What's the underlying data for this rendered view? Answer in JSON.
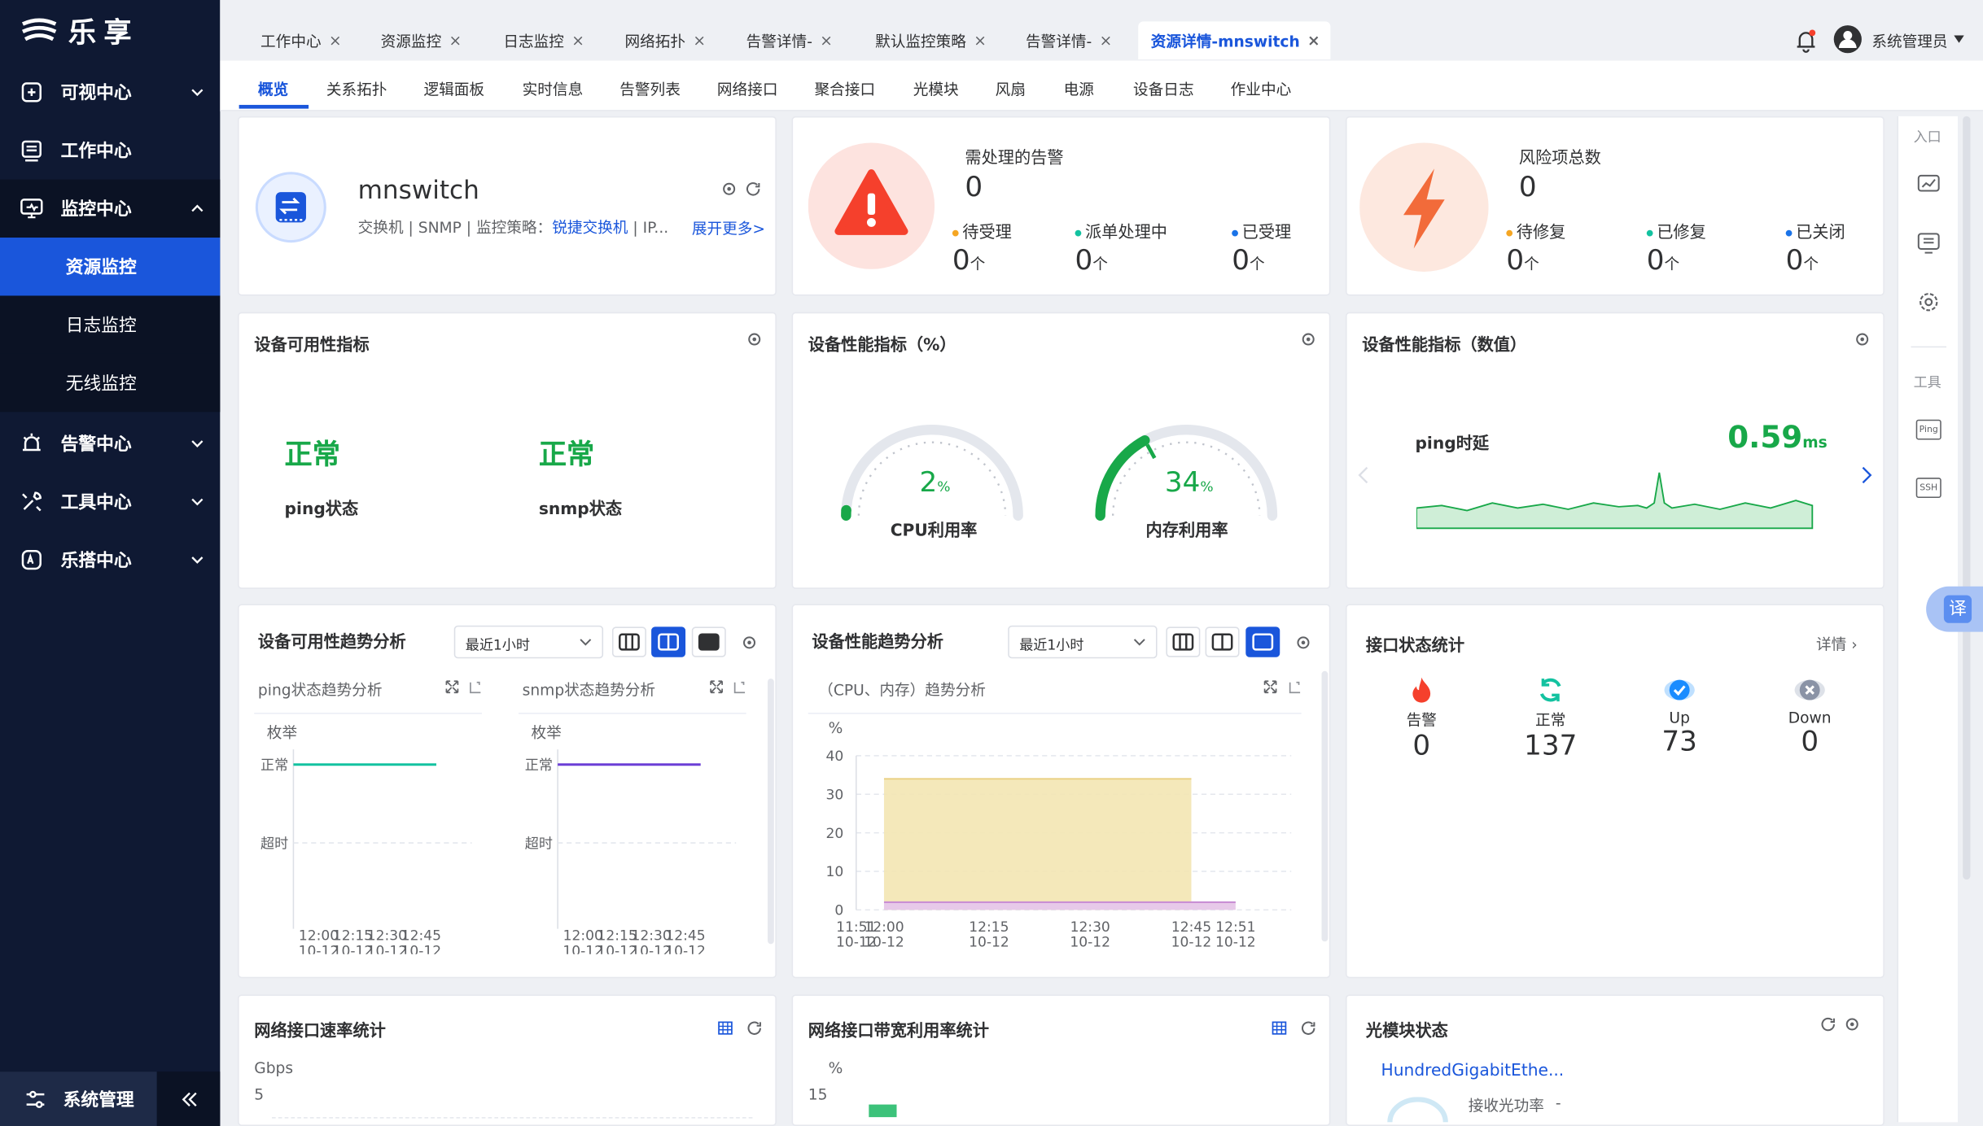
{
  "app": {
    "logo": "乐享"
  },
  "sidebar": {
    "items": [
      {
        "label": "可视中心",
        "icon": "visual-icon"
      },
      {
        "label": "工作中心",
        "icon": "work-icon"
      },
      {
        "label": "监控中心",
        "icon": "monitor-icon"
      },
      {
        "label": "告警中心",
        "icon": "alarm-icon"
      },
      {
        "label": "工具中心",
        "icon": "tools-icon"
      },
      {
        "label": "乐搭中心",
        "icon": "builder-icon"
      }
    ],
    "sub": [
      "资源监控",
      "日志监控",
      "无线监控"
    ],
    "footer": "系统管理"
  },
  "tabs": [
    "工作中心",
    "资源监控",
    "日志监控",
    "网络拓扑",
    "告警详情-",
    "默认监控策略",
    "告警详情-",
    "资源详情-mnswitch"
  ],
  "user": {
    "name": "系统管理员"
  },
  "subtabs": [
    "概览",
    "关系拓扑",
    "逻辑面板",
    "实时信息",
    "告警列表",
    "网络接口",
    "聚合接口",
    "光模块",
    "风扇",
    "电源",
    "设备日志",
    "作业中心"
  ],
  "device": {
    "name": "mnswitch",
    "desc_prefix": "交换机 | SNMP | 监控策略：",
    "policy": "锐捷交换机",
    "desc_suffix": " | IP...",
    "more": "展开更多>"
  },
  "alarms": {
    "title": "需处理的告警",
    "total": "0",
    "items": [
      {
        "label": "待受理",
        "value": "0",
        "unit": "个",
        "color": "#f5a623"
      },
      {
        "label": "派单处理中",
        "value": "0",
        "unit": "个",
        "color": "#13c2a0"
      },
      {
        "label": "已受理",
        "value": "0",
        "unit": "个",
        "color": "#1a73e8"
      }
    ]
  },
  "risks": {
    "title": "风险项总数",
    "total": "0",
    "items": [
      {
        "label": "待修复",
        "value": "0",
        "unit": "个",
        "color": "#f5a623"
      },
      {
        "label": "已修复",
        "value": "0",
        "unit": "个",
        "color": "#13c2a0"
      },
      {
        "label": "已关闭",
        "value": "0",
        "unit": "个",
        "color": "#1a73e8"
      }
    ]
  },
  "availability": {
    "title": "设备可用性指标",
    "items": [
      {
        "status": "正常",
        "label": "ping状态"
      },
      {
        "status": "正常",
        "label": "snmp状态"
      }
    ]
  },
  "perf_pct": {
    "title": "设备性能指标（%）",
    "gauges": [
      {
        "value": "2",
        "unit": "%",
        "label": "CPU利用率",
        "level": 0.02
      },
      {
        "value": "34",
        "unit": "%",
        "label": "内存利用率",
        "level": 0.34
      }
    ]
  },
  "perf_val": {
    "title": "设备性能指标（数值）",
    "label": "ping时延",
    "value": "0.59",
    "unit": "ms"
  },
  "avail_trend": {
    "title": "设备可用性趋势分析",
    "range": "最近1小时",
    "panels": [
      {
        "title": "ping状态趋势分析",
        "ylabel": "枚举",
        "yticks": [
          "正常",
          "超时"
        ],
        "xticks": [
          [
            "12:00",
            "10-12"
          ],
          [
            "12:15",
            "10-12"
          ],
          [
            "12:30",
            "10-12"
          ],
          [
            "12:45",
            "10-12"
          ]
        ],
        "color": "#13c2a0"
      },
      {
        "title": "snmp状态趋势分析",
        "ylabel": "枚举",
        "yticks": [
          "正常",
          "超时"
        ],
        "xticks": [
          [
            "12:00",
            "10-12"
          ],
          [
            "12:15",
            "10-12"
          ],
          [
            "12:30",
            "10-12"
          ],
          [
            "12:45",
            "10-12"
          ]
        ],
        "color": "#6b3fd6"
      }
    ]
  },
  "perf_trend": {
    "title": "设备性能趋势分析",
    "range": "最近1小时",
    "panel_title": "（CPU、内存）趋势分析",
    "ylabel": "%",
    "yticks": [
      "40",
      "30",
      "20",
      "10",
      "0"
    ],
    "xticks": [
      [
        "11:51",
        "10-12"
      ],
      [
        "12:00",
        "10-12"
      ],
      [
        "12:15",
        "10-12"
      ],
      [
        "12:30",
        "10-12"
      ],
      [
        "12:45",
        "10-12"
      ],
      [
        "12:51",
        "10-12"
      ]
    ]
  },
  "iface": {
    "title": "接口状态统计",
    "detail": "详情",
    "items": [
      {
        "label": "告警",
        "value": "0",
        "color": "#f5402c"
      },
      {
        "label": "正常",
        "value": "137",
        "color": "#13c2a0"
      },
      {
        "label": "Up",
        "value": "73",
        "color": "#1a8cff"
      },
      {
        "label": "Down",
        "value": "0",
        "color": "#8a93a6"
      }
    ]
  },
  "rate": {
    "title": "网络接口速率统计",
    "unit": "Gbps",
    "tick": "5"
  },
  "bw": {
    "title": "网络接口带宽利用率统计",
    "unit": "%",
    "tick": "15"
  },
  "optical": {
    "title": "光模块状态",
    "port": "HundredGigabitEthe...",
    "recv_label": "接收光功率",
    "recv_value": "-"
  },
  "rightbar": {
    "entry": "入口",
    "tools": "工具",
    "ping": "Ping",
    "ssh": "SSH"
  },
  "translate": "译",
  "chart_data": [
    {
      "type": "line",
      "title": "ping状态趋势分析",
      "ylabel": "枚举",
      "categories": [
        "12:00 10-12",
        "12:15 10-12",
        "12:30 10-12",
        "12:45 10-12"
      ],
      "series": [
        {
          "values": [
            "正常",
            "正常",
            "正常",
            "正常"
          ]
        }
      ]
    },
    {
      "type": "line",
      "title": "snmp状态趋势分析",
      "ylabel": "枚举",
      "categories": [
        "12:00 10-12",
        "12:15 10-12",
        "12:30 10-12",
        "12:45 10-12"
      ],
      "series": [
        {
          "values": [
            "正常",
            "正常",
            "正常",
            "正常"
          ]
        }
      ]
    },
    {
      "type": "area",
      "title": "（CPU、内存）趋势分析",
      "ylabel": "%",
      "ylim": [
        0,
        40
      ],
      "x": [
        "11:51",
        "12:00",
        "12:15",
        "12:30",
        "12:45",
        "12:51"
      ],
      "series": [
        {
          "values": [
            null,
            34,
            34,
            34,
            34,
            null
          ]
        },
        {
          "values": [
            null,
            2,
            2,
            2,
            2,
            2
          ]
        }
      ]
    }
  ]
}
